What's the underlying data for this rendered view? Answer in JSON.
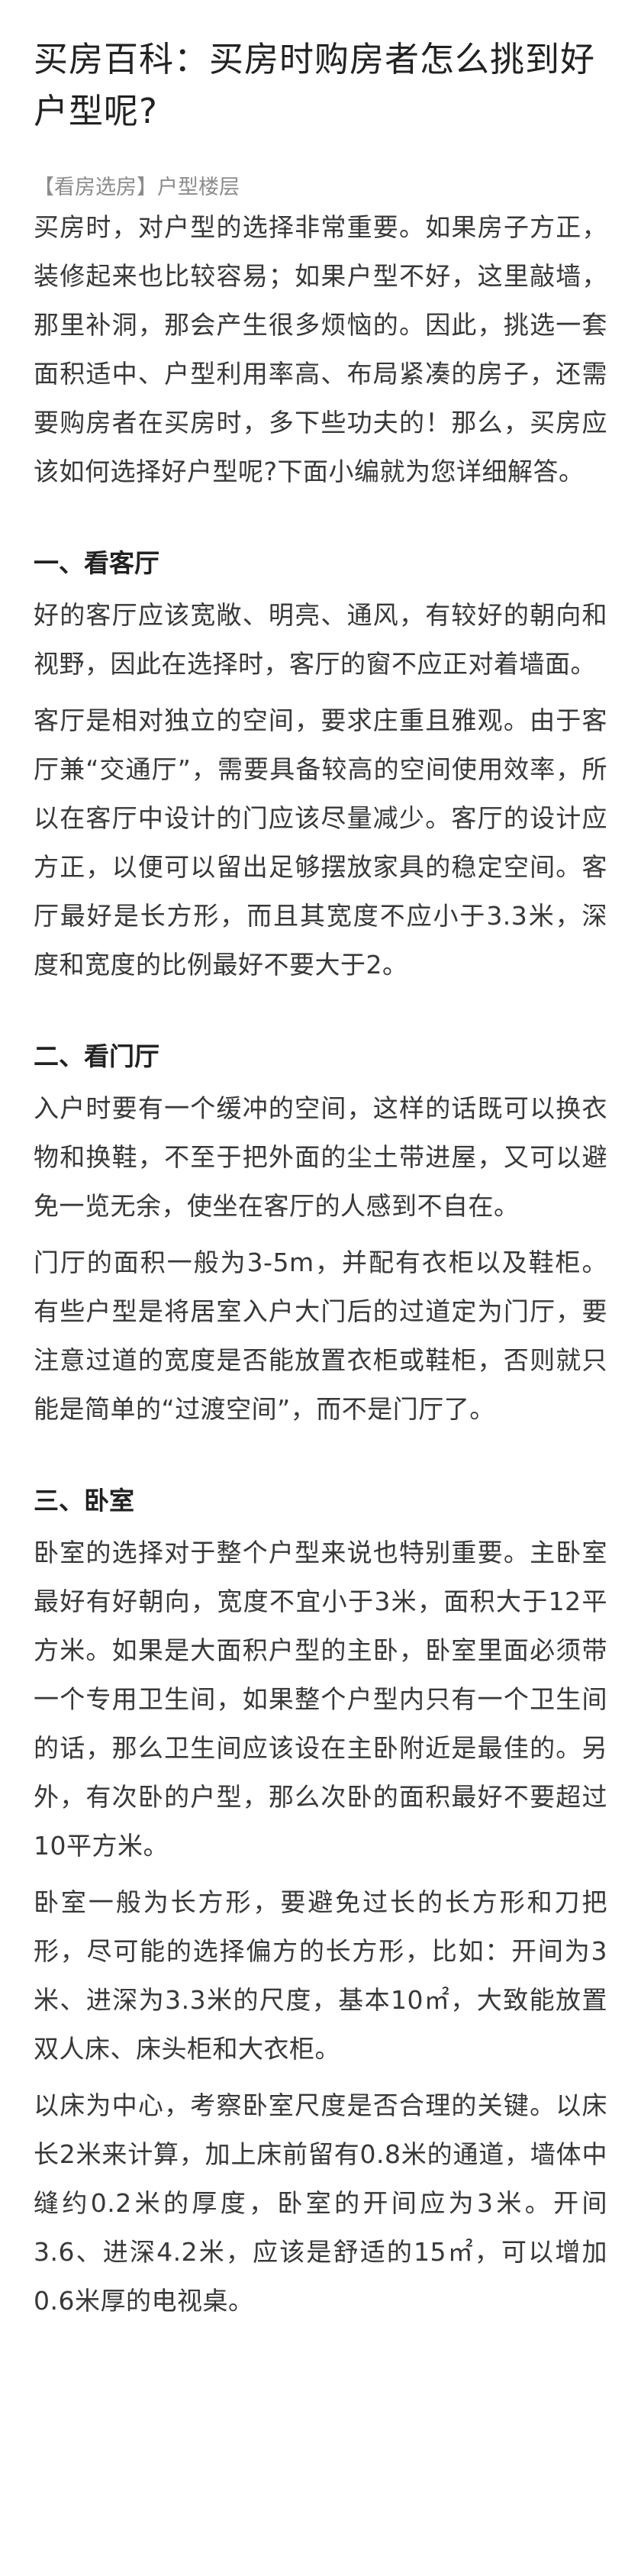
{
  "article": {
    "title": "买房百科：买房时购房者怎么挑到好户型呢?",
    "breadcrumb": {
      "open": "【",
      "category": "看房选房",
      "close": "】",
      "subcategory": "户型楼层"
    },
    "intro": "买房时，对户型的选择非常重要。如果房子方正，装修起来也比较容易；如果户型不好，这里敲墙，那里补洞，那会产生很多烦恼的。因此，挑选一套面积适中、户型利用率高、布局紧凑的房子，还需要购房者在买房时，多下些功夫的！那么，买房应该如何选择好户型呢?下面小编就为您详细解答。",
    "sections": [
      {
        "heading": "一、看客厅",
        "paragraphs": [
          "好的客厅应该宽敞、明亮、通风，有较好的朝向和视野，因此在选择时，客厅的窗不应正对着墙面。",
          "客厅是相对独立的空间，要求庄重且雅观。由于客厅兼“交通厅”，需要具备较高的空间使用效率，所以在客厅中设计的门应该尽量减少。客厅的设计应方正，以便可以留出足够摆放家具的稳定空间。客厅最好是长方形，而且其宽度不应小于3.3米，深度和宽度的比例最好不要大于2。"
        ]
      },
      {
        "heading": "二、看门厅",
        "paragraphs": [
          "入户时要有一个缓冲的空间，这样的话既可以换衣物和换鞋，不至于把外面的尘土带进屋，又可以避免一览无余，使坐在客厅的人感到不自在。",
          "门厅的面积一般为3-5m，并配有衣柜以及鞋柜。有些户型是将居室入户大门后的过道定为门厅，要注意过道的宽度是否能放置衣柜或鞋柜，否则就只能是简单的“过渡空间”，而不是门厅了。"
        ]
      },
      {
        "heading": "三、卧室",
        "paragraphs": [
          "卧室的选择对于整个户型来说也特别重要。主卧室最好有好朝向，宽度不宜小于3米，面积大于12平方米。如果是大面积户型的主卧，卧室里面必须带一个专用卫生间，如果整个户型内只有一个卫生间的话，那么卫生间应该设在主卧附近是最佳的。另外，有次卧的户型，那么次卧的面积最好不要超过10平方米。",
          "卧室一般为长方形，要避免过长的长方形和刀把形，尽可能的选择偏方的长方形，比如：开间为3米、进深为3.3米的尺度，基本10㎡，大致能放置双人床、床头柜和大衣柜。",
          "以床为中心，考察卧室尺度是否合理的关键。以床长2米来计算，加上床前留有0.8米的通道，墙体中缝约0.2米的厚度，卧室的开间应为3米。开间3.6、进深4.2米，应该是舒适的15㎡，可以增加0.6米厚的电视桌。"
        ]
      }
    ]
  }
}
